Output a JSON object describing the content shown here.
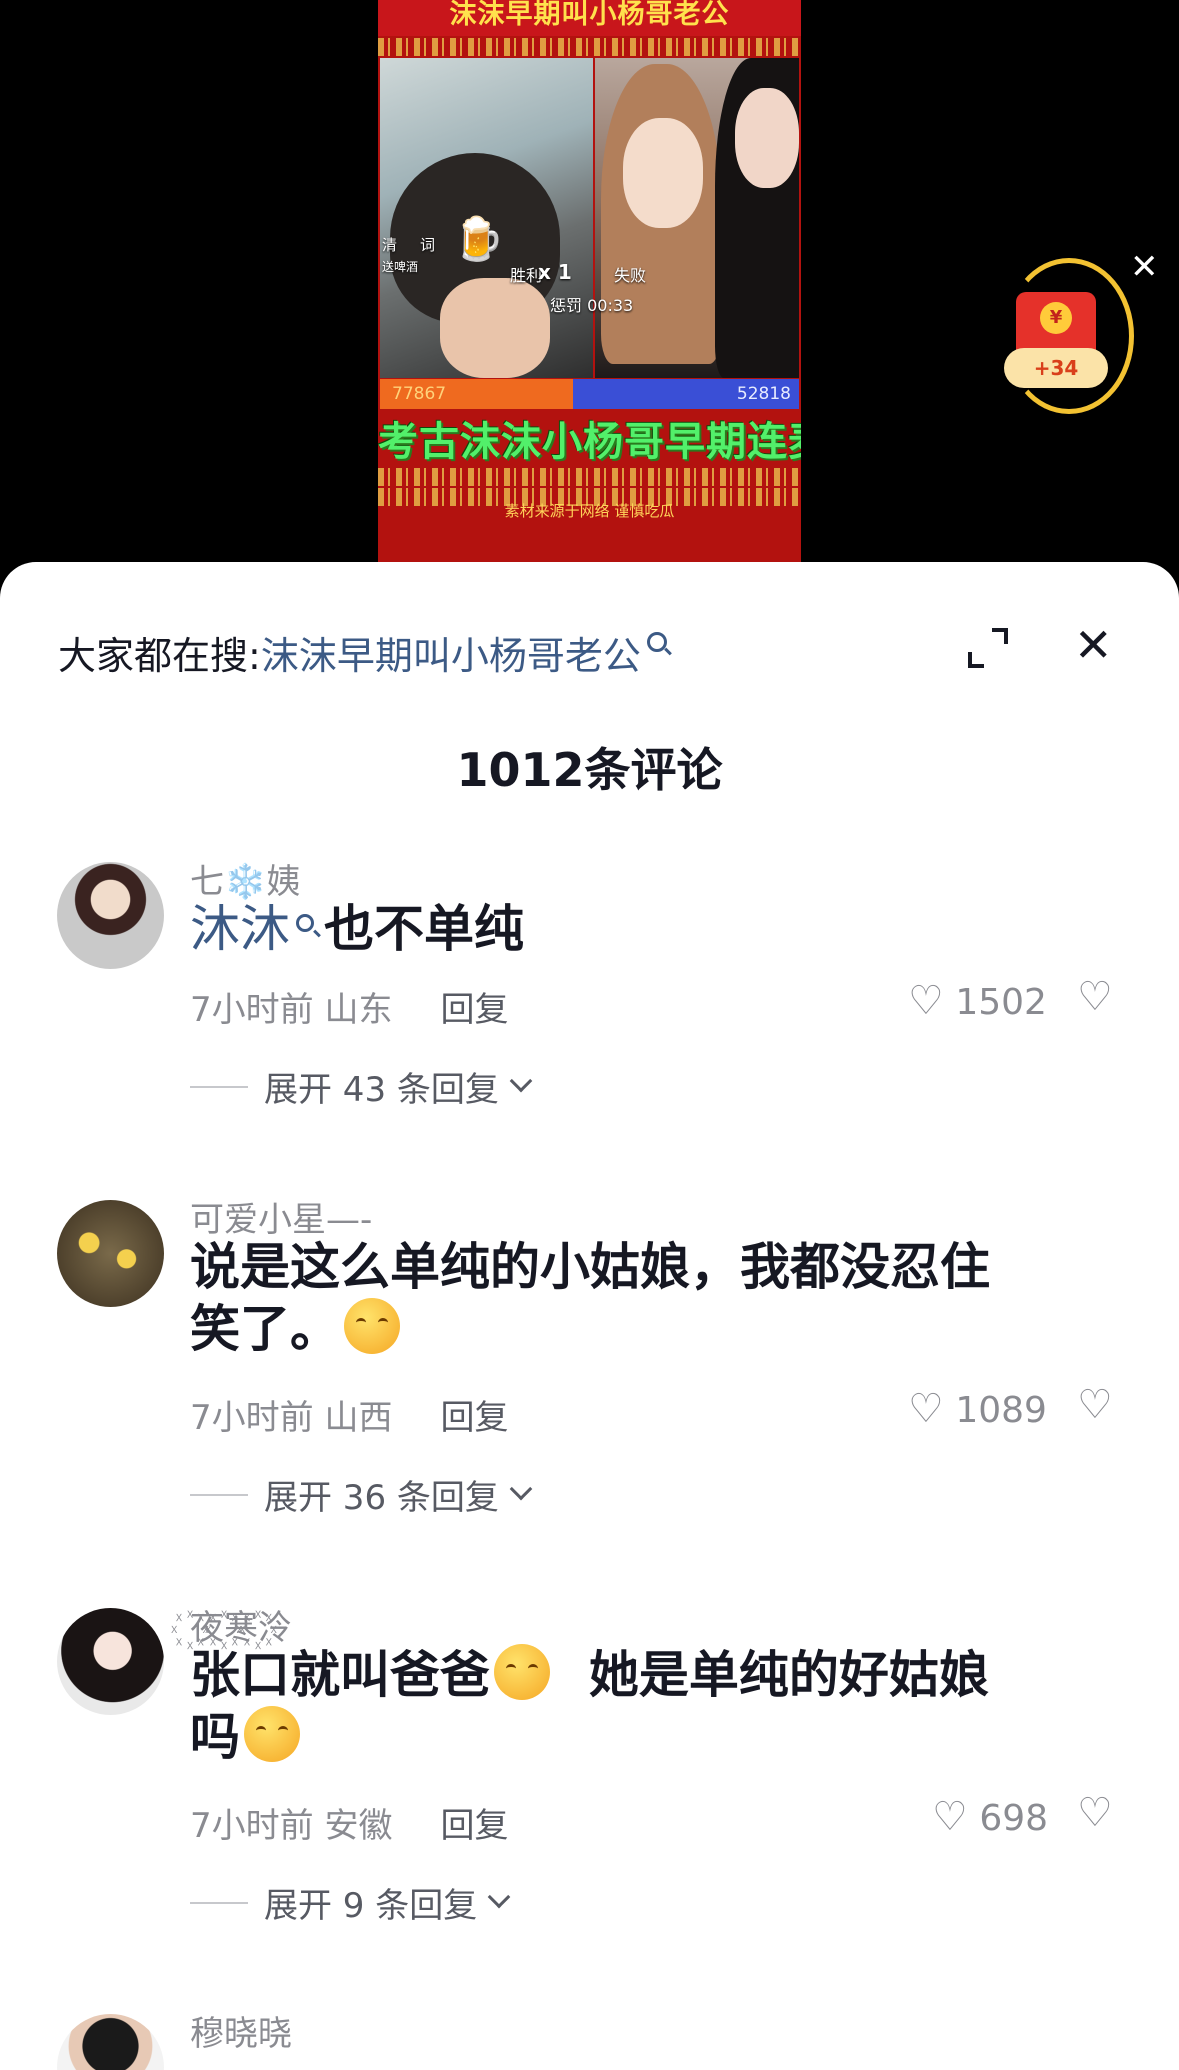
{
  "video": {
    "top_banner": "沫沫早期叫小杨哥老公",
    "bottom_banner": "考古沫沫小杨哥早期连麦",
    "credit": "素材来源于网络  谨慎吃瓜",
    "pk_labels": {
      "qing": "清",
      "ci": "词",
      "song": "送啤酒",
      "win": "胜利",
      "x1": "x 1",
      "lose": "失败",
      "penalty": "惩罚 00:33"
    },
    "score_left": "77867",
    "score_right": "52818",
    "redpacket_bonus": "+34",
    "redpacket_coin": "¥"
  },
  "sheet": {
    "search_prefix": "大家都在搜:",
    "search_term": "沫沫早期叫小杨哥老公",
    "comment_count_title": "1012条评论"
  },
  "comments": [
    {
      "username": "七❄️姨",
      "mention": "沐沐",
      "text": "也不单纯",
      "time_location": "7小时前 山东",
      "reply_label": "回复",
      "likes": "1502",
      "expand_label": "展开 43 条回复"
    },
    {
      "username": "可爱小星—-",
      "text_line1": "说是这么单纯的小姑娘，我都没忍住",
      "text_line2": "笑了。",
      "time_location": "7小时前 山西",
      "reply_label": "回复",
      "likes": "1089",
      "expand_label": "展开 36 条回复"
    },
    {
      "username": "꙰夜꙰寒꙰泠",
      "text_part1": "张口就叫爸爸",
      "text_part2": "她是单纯的好姑娘",
      "text_line2": "吗",
      "time_location": "7小时前 安徽",
      "reply_label": "回复",
      "likes": "698",
      "expand_label": "展开 9 条回复"
    },
    {
      "username": "穆晓晓"
    }
  ],
  "colors": {
    "accent_link": "#3c5a85",
    "text_primary": "#161823",
    "text_secondary": "#8a8b91"
  }
}
